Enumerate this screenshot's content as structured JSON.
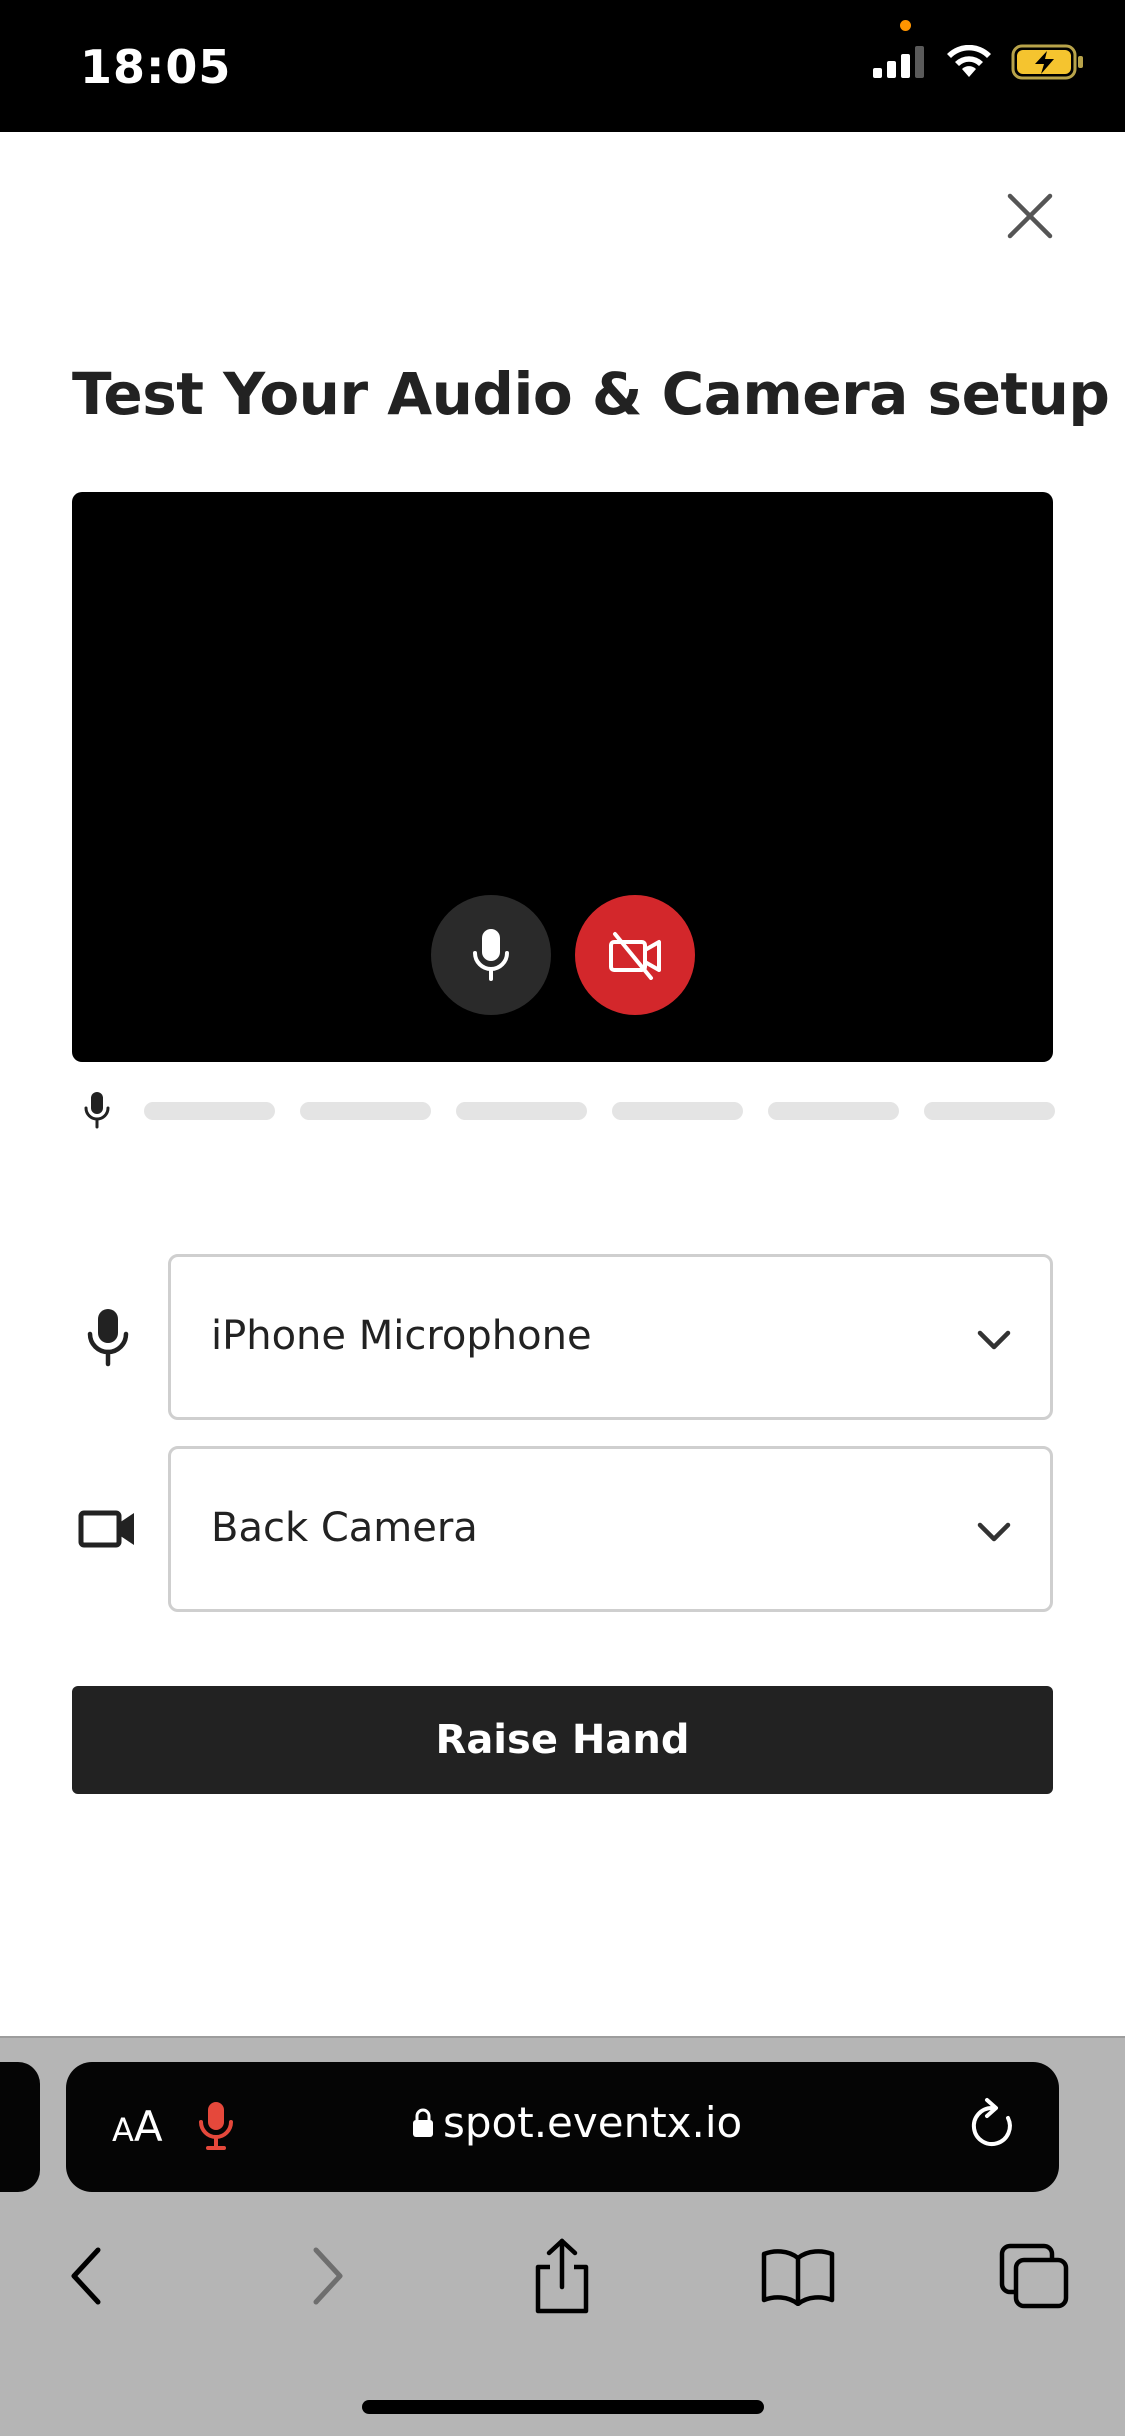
{
  "status_bar": {
    "time": "18:05"
  },
  "modal": {
    "title": "Test Your Audio & Camera setup",
    "microphone_select": {
      "value": "iPhone Microphone"
    },
    "camera_select": {
      "value": "Back Camera"
    },
    "raise_hand_label": "Raise Hand",
    "camera_state": "off",
    "mic_state": "on",
    "audio_level_segments_active": 0,
    "audio_level_segments_total": 6
  },
  "browser": {
    "text_size_label_small": "A",
    "text_size_label_large": "A",
    "url": "spot.eventx.io"
  },
  "colors": {
    "primary_dark": "#222222",
    "camera_off_red": "#d3272b",
    "mic_button_gray": "#2a2a2a",
    "meter_inactive": "#e4e4e4",
    "safari_mic_red": "#e5483b",
    "battery_yellow": "#f5c42f"
  },
  "icons": {
    "close": "close-icon",
    "mic": "microphone-icon",
    "camera_off": "camera-off-icon",
    "video": "video-camera-icon",
    "chevron": "chevron-down-icon",
    "reload": "reload-icon",
    "back": "back-icon",
    "forward": "forward-icon",
    "share": "share-icon",
    "bookmarks": "bookmarks-icon",
    "tabs": "tabs-icon"
  }
}
